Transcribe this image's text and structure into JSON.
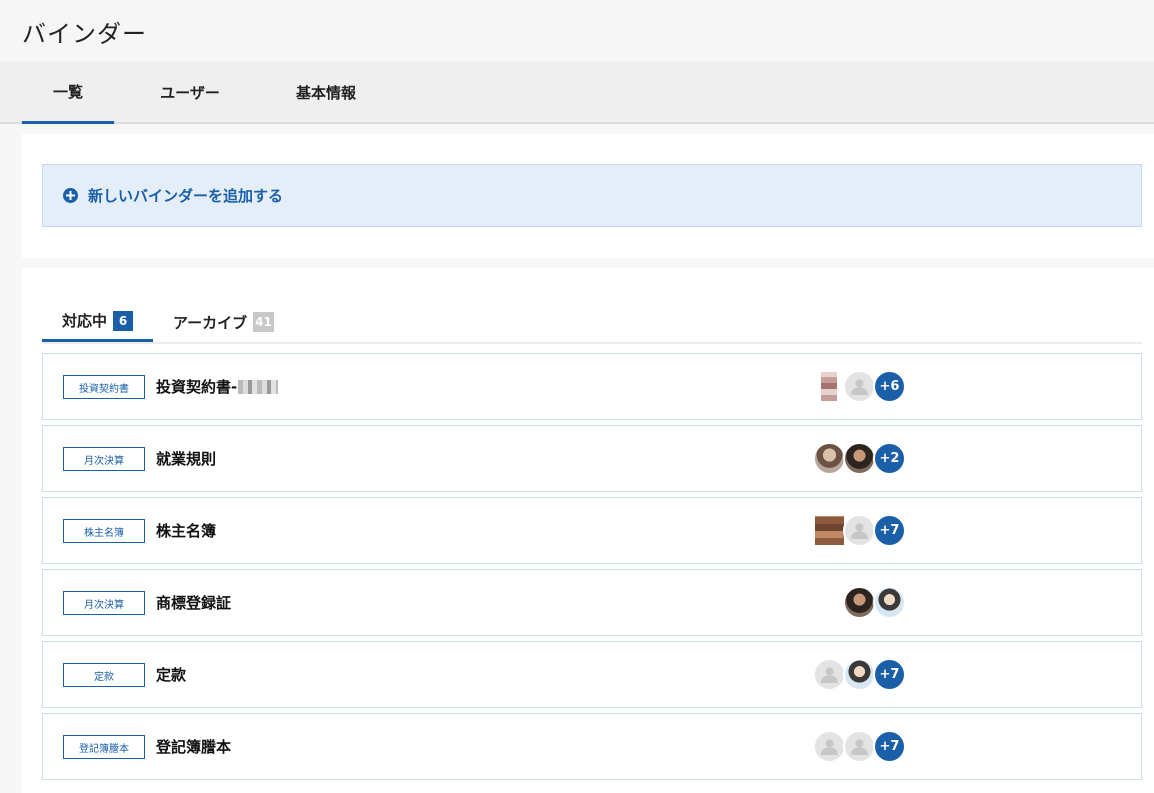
{
  "header": {
    "title": "バインダー"
  },
  "main_tabs": [
    {
      "label": "一覧",
      "active": true
    },
    {
      "label": "ユーザー",
      "active": false
    },
    {
      "label": "基本情報",
      "active": false
    }
  ],
  "add_binder": {
    "label": "新しいバインダーを追加する",
    "icon": "plus-circle-icon"
  },
  "sub_tabs": [
    {
      "label": "対応中",
      "count": "6",
      "active": true,
      "badge_color": "#1a5fa8"
    },
    {
      "label": "アーカイブ",
      "count": "41",
      "active": false,
      "badge_color": "#c8c8c8"
    }
  ],
  "binders": [
    {
      "category": "投資契約書",
      "name": "投資契約書-",
      "redacted_suffix": true,
      "avatars": [
        "pixelated-photo",
        "default-user"
      ],
      "more": "+6"
    },
    {
      "category": "月次決算",
      "name": "就業規則",
      "avatars": [
        "photo",
        "photo"
      ],
      "more": "+2"
    },
    {
      "category": "株主名簿",
      "name": "株主名簿",
      "avatars": [
        "pixelated-photo",
        "default-user"
      ],
      "more": "+7"
    },
    {
      "category": "月次決算",
      "name": "商標登録証",
      "avatars": [
        "photo",
        "photo"
      ],
      "more": ""
    },
    {
      "category": "定款",
      "name": "定款",
      "avatars": [
        "default-user",
        "photo"
      ],
      "more": "+7"
    },
    {
      "category": "登記簿謄本",
      "name": "登記簿謄本",
      "avatars": [
        "default-user",
        "default-user"
      ],
      "more": "+7"
    }
  ],
  "colors": {
    "accent": "#1a5fa8",
    "add_box_bg": "#e4eef8"
  }
}
